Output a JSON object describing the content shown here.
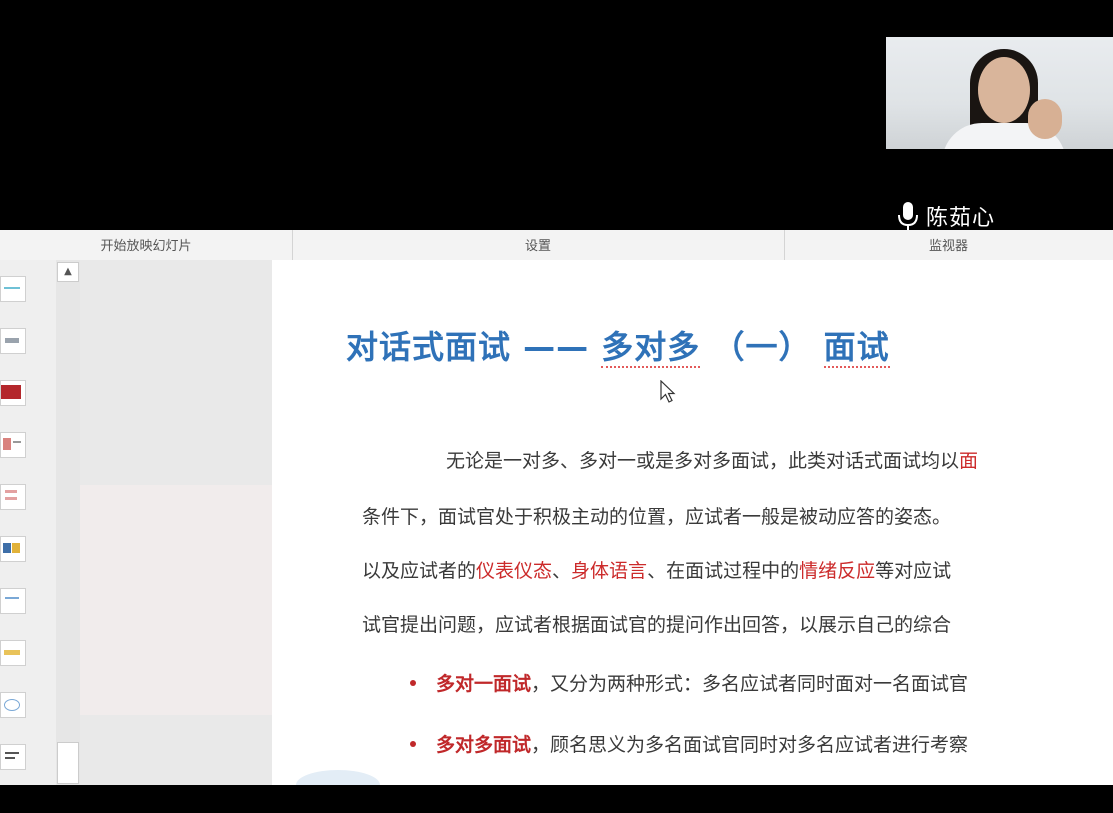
{
  "webcam": {
    "presenter_name": "陈茹心"
  },
  "toolbar": {
    "groups": [
      "开始放映幻灯片",
      "设置",
      "监视器"
    ]
  },
  "slide": {
    "title_part1": "对话式面试 —— ",
    "title_part2": "多对多",
    "title_part3": " （一） ",
    "title_part4": "面试",
    "line1": {
      "a": "无论是一对多、多对一或是多对多面试，此类对话式面试均以",
      "b": "面"
    },
    "line2": "条件下，面试官处于积极主动的位置，应试者一般是被动应答的姿态。",
    "line3": {
      "a": "以及应试者的",
      "b": "仪表仪态",
      "c": "、",
      "d": "身体语言",
      "e": "、在面试过程中的",
      "f": "情绪反应",
      "g": "等对应试"
    },
    "line4": "试官提出问题，应试者根据面试官的提问作出回答，以展示自己的综合",
    "bullet1": {
      "term": "多对一面试",
      "rest": "，又分为两种形式：多名应试者同时面对一名面试官"
    },
    "bullet2": {
      "term": "多对多面试",
      "rest": "，顾名思义为多名面试官同时对多名应试者进行考察"
    }
  },
  "colors": {
    "title_blue": "#2f72b8",
    "highlight_red": "#cc2b2b",
    "body_text": "#3a3a3a"
  },
  "icons": [
    "microphone-icon",
    "mouse-cursor-icon",
    "scroll-up-arrow-icon"
  ]
}
